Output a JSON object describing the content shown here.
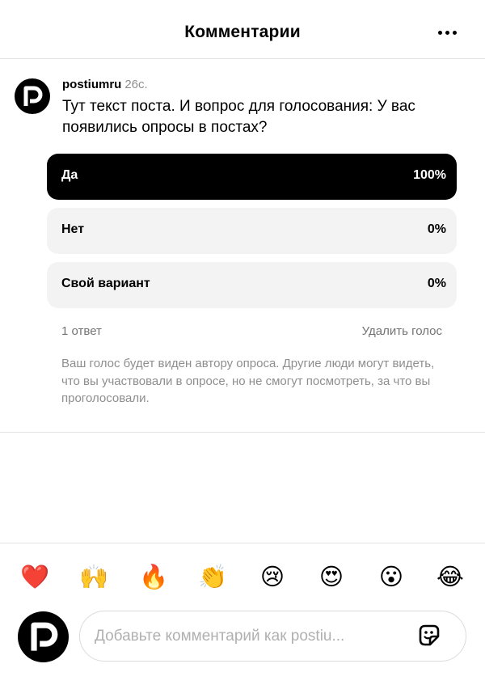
{
  "header": {
    "title": "Комментарии",
    "more_icon": "more-horizontal-icon"
  },
  "post": {
    "username": "postiumru",
    "time": "26с.",
    "text": "Тут текст поста. И вопрос для голосования: У вас появились опросы в постах?",
    "avatar_icon": "postium-logo"
  },
  "poll": {
    "options": [
      {
        "label": "Да",
        "percent": "100%",
        "share": 1.0,
        "selected": true
      },
      {
        "label": "Нет",
        "percent": "0%",
        "share": 0.0,
        "selected": false
      },
      {
        "label": "Свой вариант",
        "percent": "0%",
        "share": 0.0,
        "selected": false
      }
    ],
    "answers_count": "1 ответ",
    "remove_vote": "Удалить голос",
    "note": "Ваш голос будет виден автору опроса. Другие люди могут видеть, что вы участвовали в опросе, но не смогут посмотреть, за что вы проголосовали."
  },
  "reactions": [
    {
      "char": "❤️",
      "name": "heart"
    },
    {
      "char": "🙌",
      "name": "raising-hands"
    },
    {
      "char": "🔥",
      "name": "fire"
    },
    {
      "char": "👏",
      "name": "clapping-hands"
    },
    {
      "char": "😢",
      "name": "crying-face"
    },
    {
      "char": "😍",
      "name": "heart-eyes"
    },
    {
      "char": "😮",
      "name": "surprised-face"
    },
    {
      "char": "😂",
      "name": "tears-of-joy"
    }
  ],
  "composer": {
    "placeholder": "Добавьте комментарий как postiu...",
    "sticker_icon": "sticker-icon"
  },
  "colors": {
    "selected_fill": "#000000",
    "option_bg": "#f3f3f3",
    "muted_text": "#8e8e8e",
    "divider": "#e3e3e3"
  }
}
